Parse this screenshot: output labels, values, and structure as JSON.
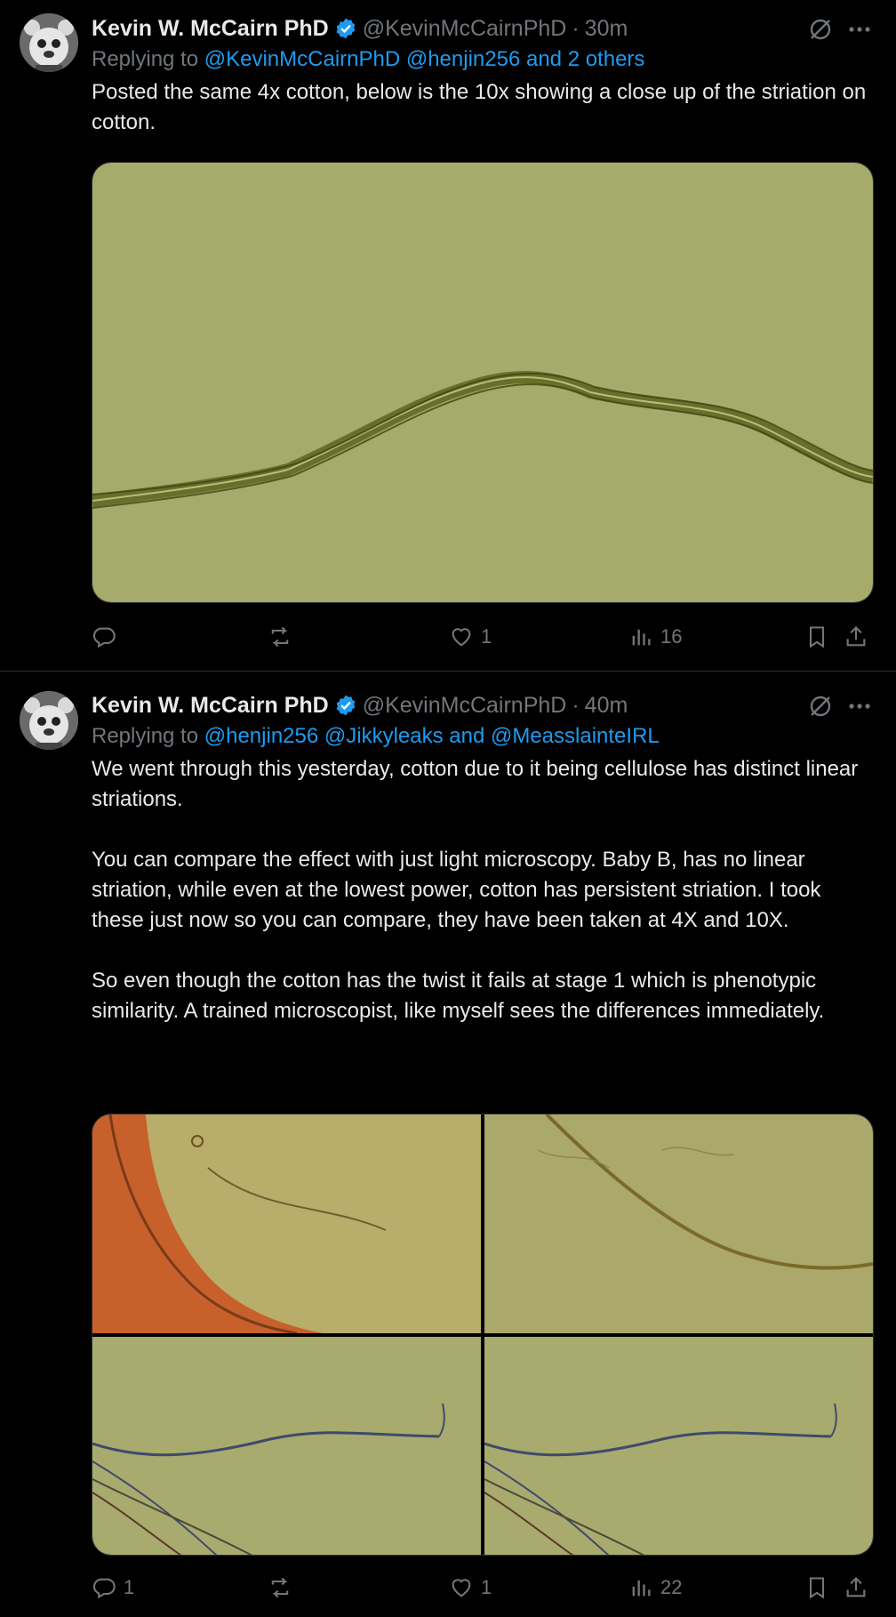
{
  "tweets": [
    {
      "author": "Kevin W. McCairn PhD",
      "handle": "@KevinMcCairnPhD",
      "time": "30m",
      "replying_prefix": "Replying to ",
      "replying_to": "@KevinMcCairnPhD @henjin256 and 2 others",
      "text": "Posted the same 4x cotton, below is the 10x showing a close up of the striation on cotton.",
      "stats": {
        "replies": "",
        "retweets": "",
        "likes": "1",
        "views": "16"
      }
    },
    {
      "author": "Kevin W. McCairn PhD",
      "handle": "@KevinMcCairnPhD",
      "time": "40m",
      "replying_prefix": "Replying to ",
      "replying_to": "@henjin256 @Jikkyleaks and @MeasslainteIRL",
      "text": "We went through this yesterday, cotton due to it being cellulose has distinct linear striations.\n\nYou can compare the effect with just light microscopy. Baby B, has no linear striation, while even at the lowest power, cotton has persistent striation. I took these just now so you can compare, they have been taken at 4X and 10X.\n\nSo even though the cotton has the twist it fails at stage 1 which is phenotypic similarity. A trained microscopist, like myself sees the differences immediately.",
      "stats": {
        "replies": "1",
        "retweets": "",
        "likes": "1",
        "views": "22"
      }
    }
  ],
  "colors": {
    "accent": "#1d9bf0",
    "muted": "#71767b",
    "background": "#000000",
    "text": "#e7e9ea"
  },
  "icons": [
    "verified-badge-icon",
    "grok-icon",
    "more-icon",
    "reply-icon",
    "retweet-icon",
    "like-icon",
    "views-icon",
    "bookmark-icon",
    "share-icon"
  ]
}
